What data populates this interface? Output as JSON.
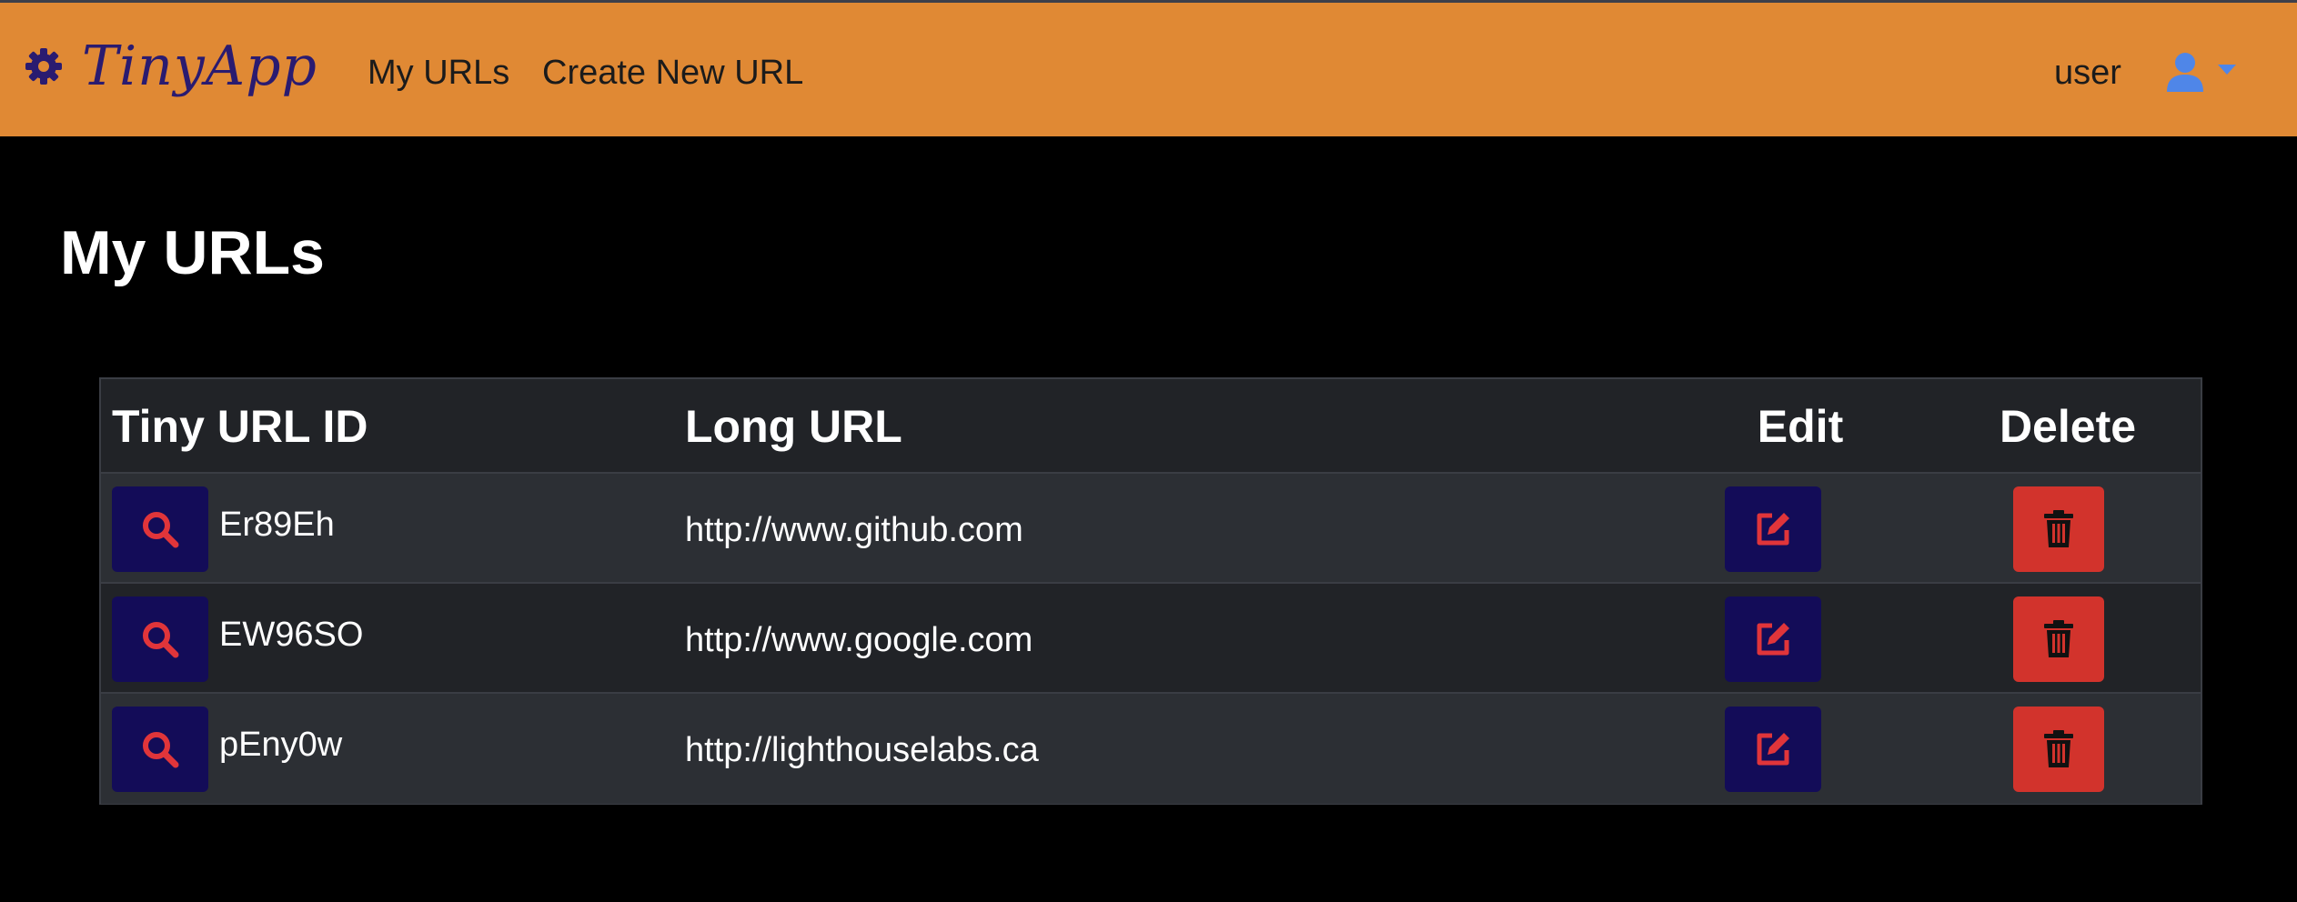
{
  "navbar": {
    "brand": "TinyApp",
    "brand_icon": "gear-icon",
    "links": [
      {
        "label": "My URLs"
      },
      {
        "label": "Create New URL"
      }
    ],
    "user_label": "user",
    "user_icon": "user-icon",
    "dropdown_icon": "caret-down-icon"
  },
  "page": {
    "title": "My URLs"
  },
  "table": {
    "headers": {
      "id": "Tiny URL ID",
      "long": "Long URL",
      "edit": "Edit",
      "delete": "Delete"
    },
    "rows": [
      {
        "id": "Er89Eh",
        "long_url": "http://www.github.com"
      },
      {
        "id": "EW96SO",
        "long_url": "http://www.google.com"
      },
      {
        "id": "pEny0w",
        "long_url": "http://lighthouselabs.ca"
      }
    ],
    "view_icon": "search-icon",
    "edit_icon": "edit-icon",
    "delete_icon": "trash-icon"
  },
  "colors": {
    "navbar_bg": "#e08934",
    "brand": "#2a1b70",
    "button_dark": "#130c58",
    "button_danger": "#d2332c",
    "icon_accent": "#e0353a",
    "user_icon": "#4f86e8"
  }
}
